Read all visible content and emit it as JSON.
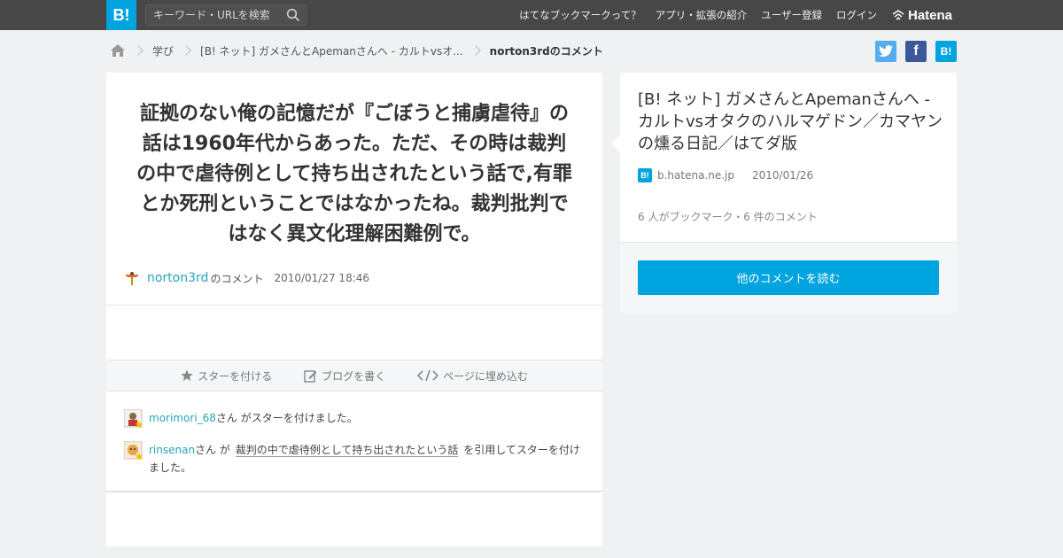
{
  "header": {
    "logo": "B!",
    "search": {
      "placeholder": "キーワード・URLを検索"
    },
    "nav": [
      "はてなブックマークって？",
      "アプリ・拡張の紹介",
      "ユーザー登録",
      "ログイン"
    ],
    "brand": "Hatena"
  },
  "breadcrumb": {
    "category": "学び",
    "entry": "[B! ネット] ガメさんとApemanさんへ - カルトvsオ...",
    "current": "norton3rdのコメント"
  },
  "share": {
    "facebook": "f",
    "hatena": "B!"
  },
  "comment": {
    "text": "証拠のない俺の記憶だが『ごぼうと捕虜虐待』の話は1960年代からあった。ただ、その時は裁判の中で虐待例として持ち出されたという話で,有罪とか死刑ということではなかったね。裁判批判ではなく異文化理解困難例で。",
    "user": "norton3rd",
    "user_suffix": "のコメント",
    "date": "2010/01/27 18:46"
  },
  "actions": {
    "star": "スターを付ける",
    "blog": "ブログを書く",
    "embed": "ページに埋め込む"
  },
  "stars": [
    {
      "user": "morimori_68",
      "text": "さん がスターを付けました。"
    },
    {
      "user": "rinsenan",
      "pre": "さん が",
      "quote": "裁判の中で虐待例として持ち出されたという話",
      "post": "を引用してスターを付けました。"
    }
  ],
  "entry": {
    "title": "[B! ネット] ガメさんとApemanさんへ - カルトvsオタクのハルマゲドン／カマヤンの燻る日記／はてダ版",
    "domain": "b.hatena.ne.jp",
    "date": "2010/01/26",
    "counts": "6 人がブックマーク・6 件のコメント",
    "button": "他のコメントを読む"
  },
  "colors": {
    "topbar": "#474747",
    "accent": "#00a4de",
    "link": "#25a6b8",
    "twitter": "#55acee",
    "facebook": "#3b5998"
  }
}
